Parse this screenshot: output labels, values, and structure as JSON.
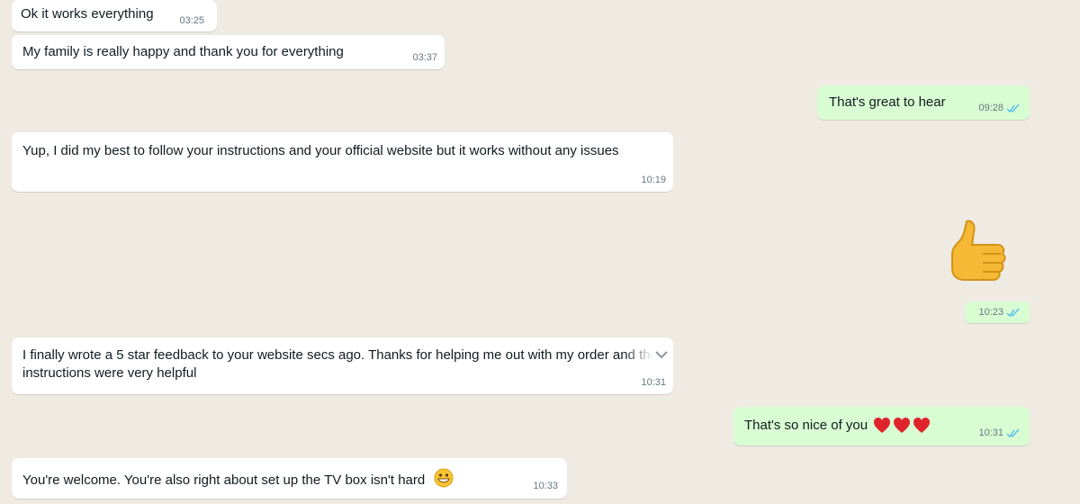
{
  "messages": [
    {
      "direction": "in",
      "text": "Ok it works everything",
      "time": "03:25"
    },
    {
      "direction": "in",
      "text": "My family is really happy and thank you for everything",
      "time": "03:37"
    },
    {
      "direction": "out",
      "text": "That's great to hear",
      "time": "09:28",
      "status": "read"
    },
    {
      "direction": "in",
      "text": "Yup, I did my best to follow your instructions and your official website but it works without any issues",
      "time": "10:19"
    },
    {
      "direction": "out",
      "text": "",
      "emoji": "thumbs-up",
      "time": "10:23",
      "status": "read"
    },
    {
      "direction": "in",
      "text": "I finally wrote a 5 star feedback to your website secs ago. Thanks for helping me out with my order and the instructions were very helpful",
      "time": "10:31"
    },
    {
      "direction": "out",
      "text": "That's so nice of you",
      "emoji": "red-heart x3",
      "time": "10:31",
      "status": "read"
    },
    {
      "direction": "in",
      "text": "You're welcome. You're also right about set up the TV box isn't hard",
      "emoji": "grinning-face",
      "time": "10:33"
    }
  ],
  "colors": {
    "background": "#efeae2",
    "incoming_bubble": "#ffffff",
    "outgoing_bubble": "#d9fdd3",
    "read_ticks": "#53bdeb",
    "meta_text": "#667781"
  }
}
